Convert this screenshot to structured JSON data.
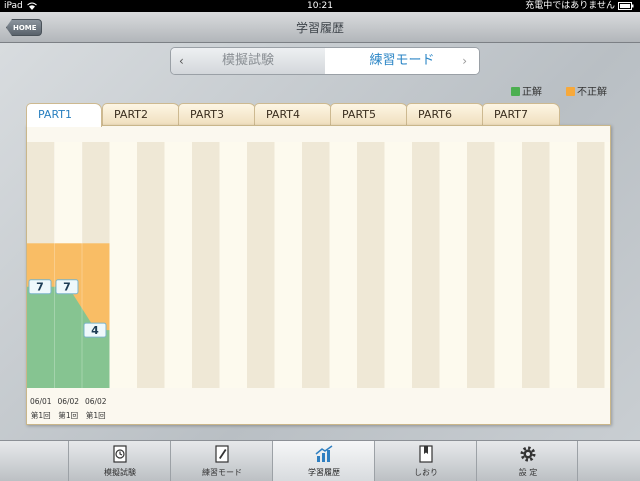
{
  "status_bar": {
    "device": "iPad",
    "time": "10:21",
    "battery_text": "充電中ではありません"
  },
  "nav": {
    "home_label": "HOME",
    "title": "学習履歴"
  },
  "segment": {
    "options": [
      "模擬試験",
      "練習モード"
    ],
    "selected": "練習モード",
    "left_arrow": "‹",
    "right_arrow": "›"
  },
  "legend": {
    "correct_label": "正解",
    "incorrect_label": "不正解",
    "correct_color": "#4caf50",
    "incorrect_color": "#f7a93b"
  },
  "tabs": [
    "PART1",
    "PART2",
    "PART3",
    "PART4",
    "PART5",
    "PART6",
    "PART7"
  ],
  "active_tab": "PART1",
  "chart_data": {
    "type": "area",
    "x": [
      "06/01",
      "06/02",
      "06/02"
    ],
    "x_sublabels": [
      "第1回",
      "第1回",
      "第1回"
    ],
    "series": [
      {
        "values": [
          7,
          7,
          4
        ],
        "data_labels": [
          "7",
          "7",
          "4"
        ],
        "color": "#86c491"
      },
      {
        "values": [
          10,
          10,
          10
        ],
        "color": "#f9bd65"
      }
    ],
    "ylim": [
      0,
      17
    ],
    "title": "",
    "xlabel": "",
    "ylabel": ""
  },
  "bottom_tabs": [
    {
      "label": "模擬試験",
      "icon": "clock-document-icon"
    },
    {
      "label": "練習モード",
      "icon": "pencil-document-icon"
    },
    {
      "label": "学習履歴",
      "icon": "chart-icon"
    },
    {
      "label": "しおり",
      "icon": "bookmark-icon"
    },
    {
      "label": "設 定",
      "icon": "gear-icon"
    }
  ],
  "active_bottom_tab": "学習履歴"
}
